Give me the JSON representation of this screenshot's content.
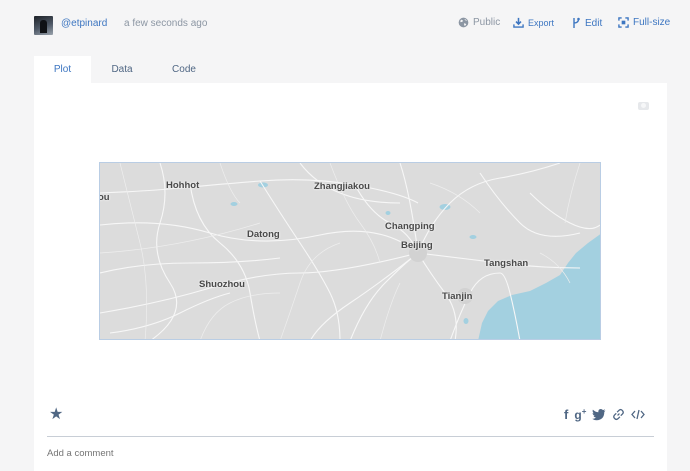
{
  "header": {
    "username": "@etpinard",
    "timestamp": "a few seconds ago",
    "public_label": "Public",
    "export_label": "Export",
    "edit_label": "Edit",
    "fullsize_label": "Full-size"
  },
  "tabs": [
    {
      "label": "Plot",
      "active": true
    },
    {
      "label": "Data",
      "active": false
    },
    {
      "label": "Code",
      "active": false
    }
  ],
  "map": {
    "type": "mapbox",
    "land_color": "#dcdcdc",
    "water_color": "#a3d0e0",
    "cities": [
      "Hohhot",
      "Zhangjiakou",
      "Datong",
      "Changping",
      "Beijing",
      "Tangshan",
      "Shuozhou",
      "Tianjin",
      "ou"
    ]
  },
  "footer": {
    "comment_placeholder": "Add a comment",
    "share_icons": [
      "facebook-icon",
      "google-plus-icon",
      "twitter-icon",
      "link-icon",
      "embed-icon"
    ]
  },
  "colors": {
    "accent": "#3d76c1",
    "text": "#506784",
    "muted": "#8c96a3"
  }
}
